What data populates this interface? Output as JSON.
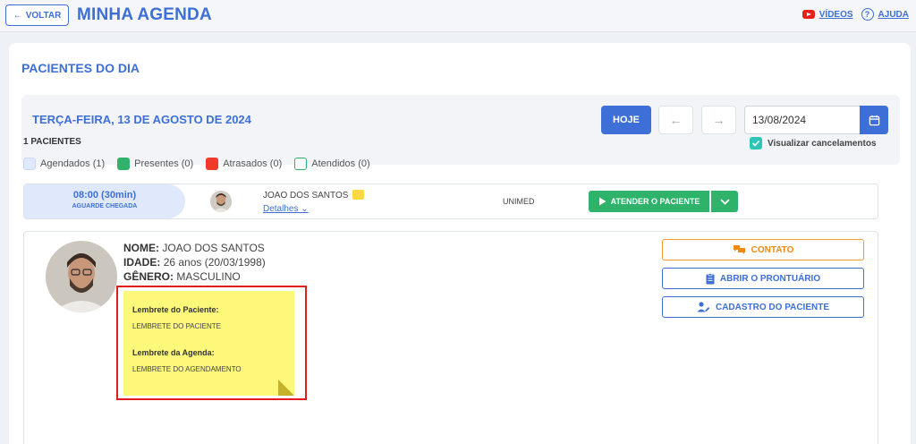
{
  "header": {
    "back_label": "VOLTAR",
    "title": "MINHA AGENDA",
    "videos_label": "VÍDEOS",
    "help_label": "AJUDA"
  },
  "section": {
    "title": "PACIENTES DO DIA"
  },
  "date_panel": {
    "date_label": "TERÇA-FEIRA, 13 DE AGOSTO DE 2024",
    "today_label": "HOJE",
    "prev_arrow": "←",
    "next_arrow": "→",
    "date_value": "13/08/2024",
    "show_cancellations_label": "Visualizar cancelamentos",
    "show_cancellations_checked": true
  },
  "summary": {
    "count_label": "1 PACIENTES"
  },
  "legend": [
    {
      "label": "Agendados (1)",
      "color": "#dfe9fb",
      "border": "#c9d8f5"
    },
    {
      "label": "Presentes (0)",
      "color": "#2fb36b",
      "border": "#2fb36b"
    },
    {
      "label": "Atrasados (0)",
      "color": "#f23a2a",
      "border": "#f23a2a"
    },
    {
      "label": "Atendidos (0)",
      "color": "#ffffff",
      "border": "#2fb36b"
    }
  ],
  "appointment": {
    "time": "08:00 (30min)",
    "status": "AGUARDE CHEGADA",
    "patient_name": "JOAO DOS SANTOS",
    "details_label": "Detalhes",
    "insurer": "UNIMED",
    "attend_label": "ATENDER O PACIENTE"
  },
  "patient": {
    "name_label": "NOME:",
    "name_value": "JOAO DOS SANTOS",
    "age_label": "IDADE:",
    "age_value": "26 anos (20/03/1998)",
    "gender_label": "GÊNERO:",
    "gender_value": "MASCULINO"
  },
  "reminders": {
    "patient_title": "Lembrete do Paciente:",
    "patient_text": "LEMBRETE DO PACIENTE",
    "schedule_title": "Lembrete da Agenda:",
    "schedule_text": "LEMBRETE DO AGENDAMENTO"
  },
  "actions": {
    "contact_label": "CONTATO",
    "open_record_label": "ABRIR O PRONTUÁRIO",
    "patient_register_label": "CADASTRO DO PACIENTE"
  },
  "colors": {
    "primary": "#3d6fd6",
    "success": "#2fb36b",
    "warning": "#f08a12",
    "sticky": "#fdf77a",
    "highlight_frame": "#e31d1d"
  }
}
